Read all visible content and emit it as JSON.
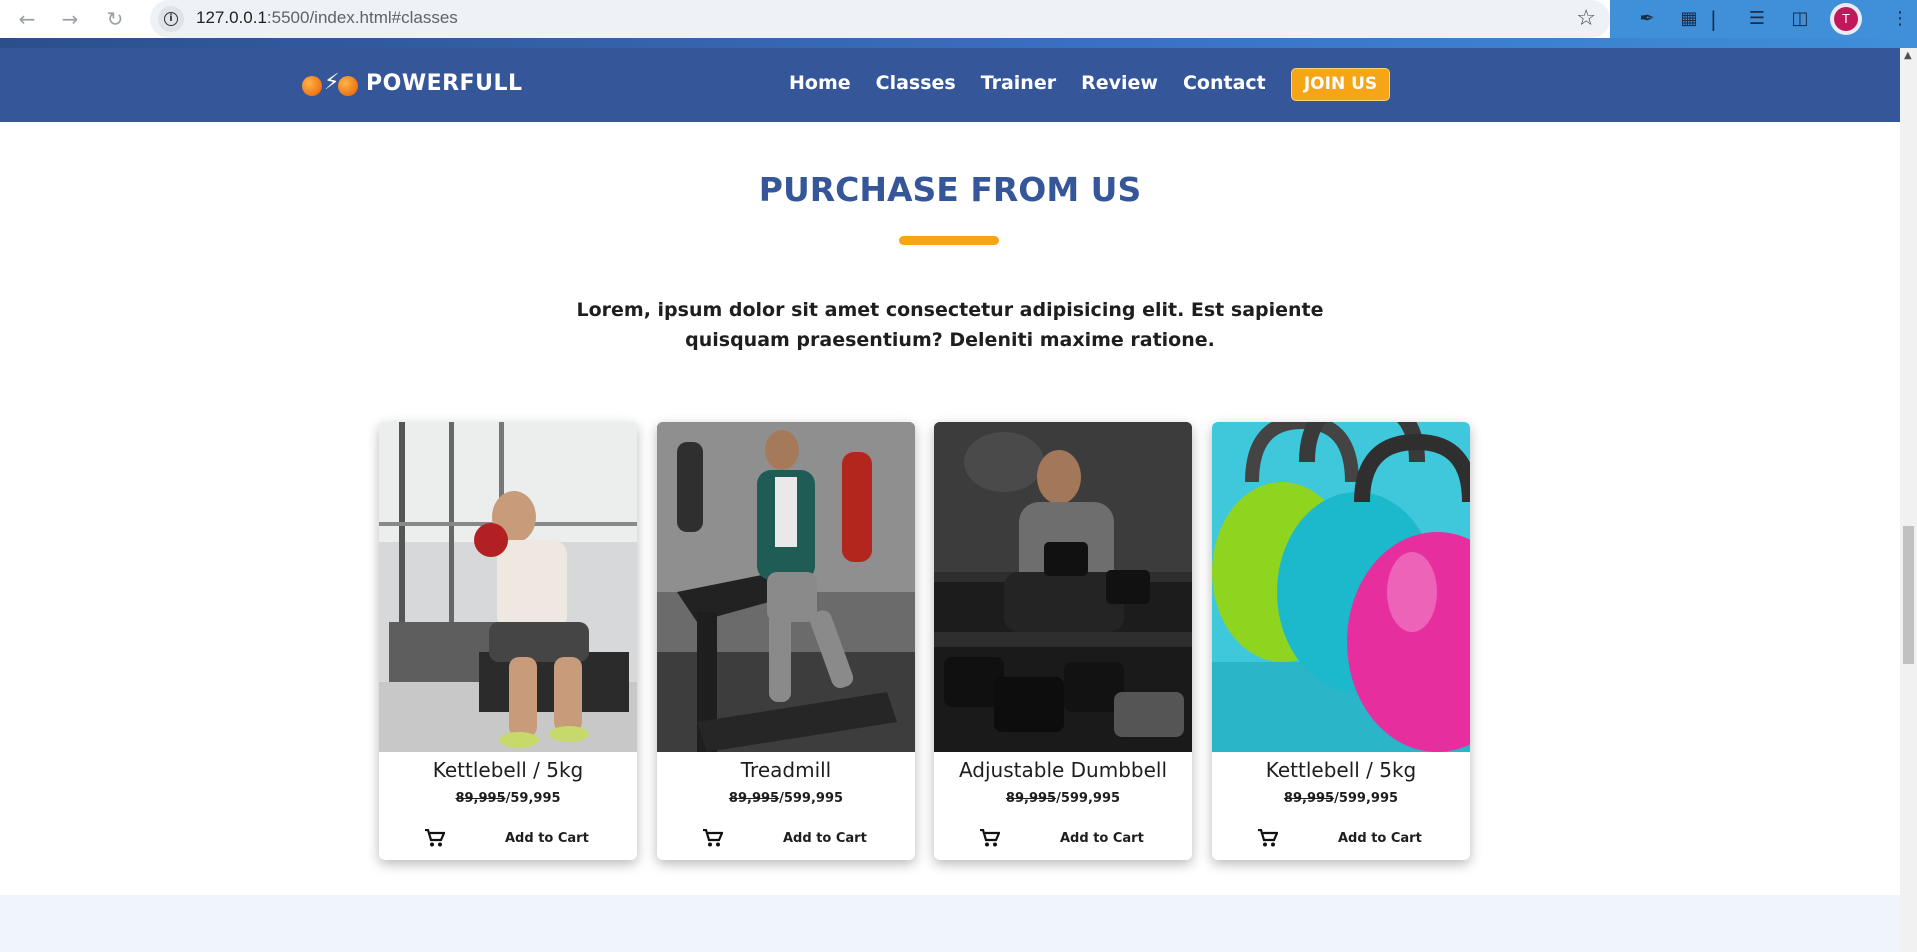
{
  "browser": {
    "url_host": "127.0.0.1",
    "url_path": ":5500/index.html#classes",
    "avatar_letter": "T"
  },
  "header": {
    "logo_text": "POWERFULL",
    "nav": [
      "Home",
      "Classes",
      "Trainer",
      "Review",
      "Contact"
    ],
    "join_label": "JOIN US"
  },
  "section": {
    "title": "PURCHASE FROM US",
    "description": "Lorem, ipsum dolor sit amet consectetur adipisicing elit. Est sapiente quisquam praesentium? Deleniti maxime ratione."
  },
  "products": [
    {
      "name": "Kettlebell / 5kg",
      "old_price": "89,995",
      "price": "/59,995",
      "cart_label": "Add to Cart"
    },
    {
      "name": "Treadmill",
      "old_price": "89,995",
      "price": "/599,995",
      "cart_label": "Add to Cart"
    },
    {
      "name": "Adjustable Dumbbell",
      "old_price": "89,995",
      "price": "/599,995",
      "cart_label": "Add to Cart"
    },
    {
      "name": "Kettlebell / 5kg",
      "old_price": "89,995",
      "price": "/599,995",
      "cart_label": "Add to Cart"
    }
  ],
  "colors": {
    "header_bg": "#35579a",
    "accent": "#f5a516",
    "title": "#35579a"
  }
}
